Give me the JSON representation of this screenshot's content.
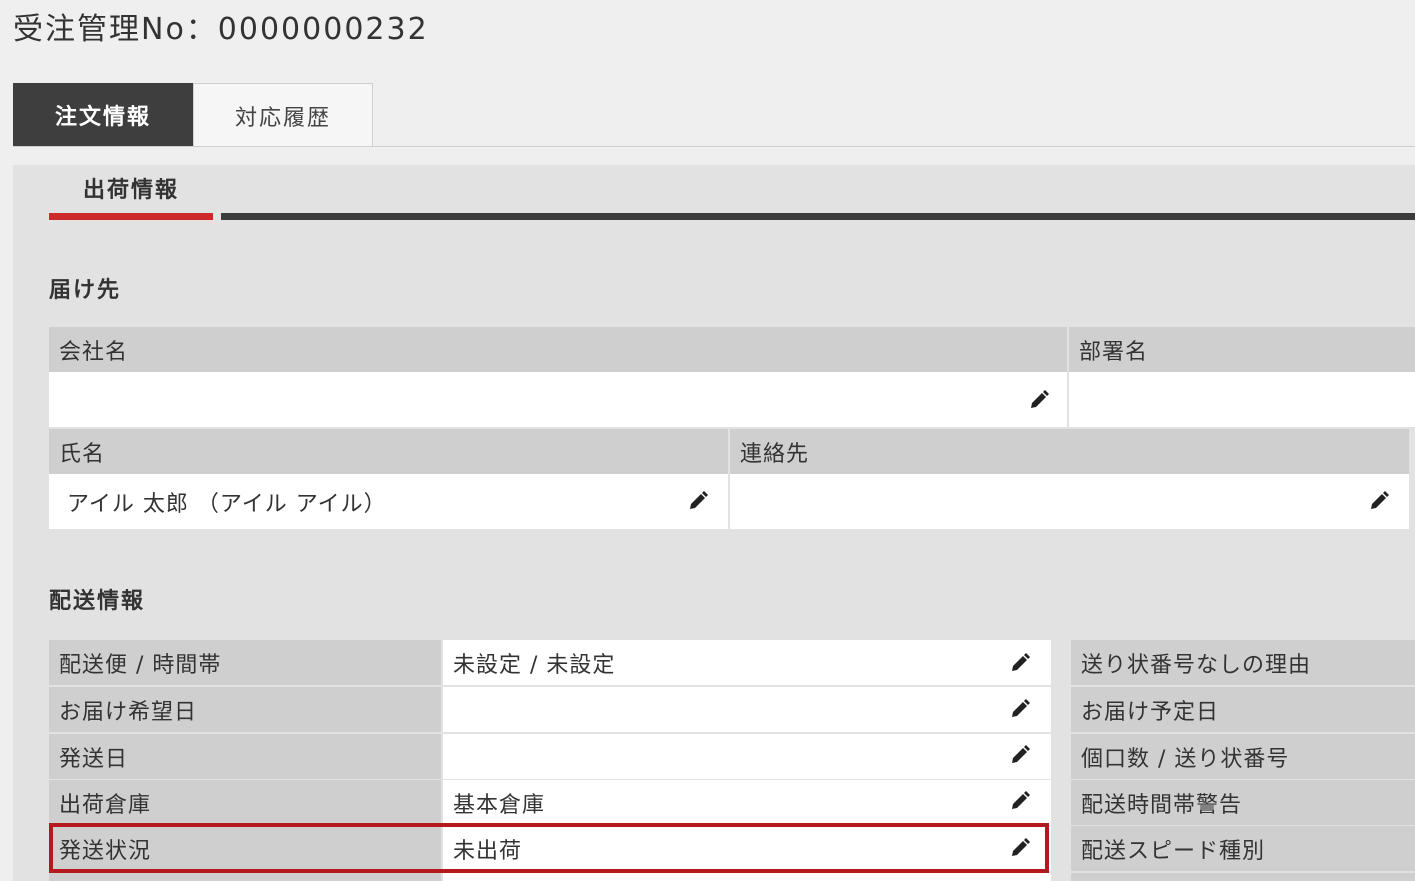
{
  "header": {
    "title": "受注管理No：0000000232"
  },
  "tabs": [
    {
      "label": "注文情報",
      "active": true
    },
    {
      "label": "対応履歴",
      "active": false
    }
  ],
  "subtab": {
    "label": "出荷情報"
  },
  "recipient": {
    "section_title": "届け先",
    "company_label": "会社名",
    "company_value": "",
    "department_label": "部署名",
    "department_value": "",
    "name_label": "氏名",
    "name_value": "アイル 太郎 （アイル アイル）",
    "contact_label": "連絡先",
    "contact_value": ""
  },
  "shipping": {
    "section_title": "配送情報",
    "rows": [
      {
        "label": "配送便 / 時間帯",
        "value": "未設定 / 未設定",
        "right_label": "送り状番号なしの理由"
      },
      {
        "label": "お届け希望日",
        "value": "",
        "right_label": "お届け予定日"
      },
      {
        "label": "発送日",
        "value": "",
        "right_label": "個口数 / 送り状番号"
      },
      {
        "label": "出荷倉庫",
        "value": "基本倉庫",
        "right_label": "配送時間帯警告"
      },
      {
        "label": "発送状況",
        "value": "未出荷",
        "right_label": "配送スピード種別"
      }
    ]
  },
  "colors": {
    "accent_red": "#cc2a2a",
    "highlight_border": "#b3191f",
    "tab_dark": "#3e3e3e"
  },
  "icons": {
    "edit": "pencil-icon"
  }
}
